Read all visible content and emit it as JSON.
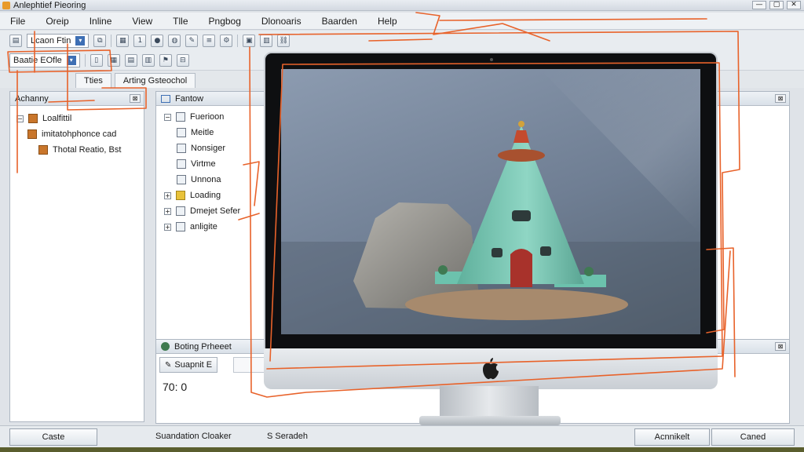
{
  "window": {
    "title": "Anlephtief Pieoring",
    "controls": [
      "—",
      "▢",
      "✕"
    ]
  },
  "menu": [
    "File",
    "Oreip",
    "Inline",
    "View",
    "Tlle",
    "Pngbog",
    "Dlonoaris",
    "Baarden",
    "Help"
  ],
  "toolbar1": {
    "combo_label": "Lcaon Ftin"
  },
  "toolbar2": {
    "combo_label": "Baatie EOfle"
  },
  "tabs": [
    "Tties",
    "Arting Gsteochol"
  ],
  "left_panel": {
    "title": "Achanny",
    "items": [
      "Loalfittil",
      "imitatohphonce cad",
      "Thotal Reatio, Bst"
    ]
  },
  "mid_panel": {
    "title": "Fantow",
    "items": [
      "Fuerioon",
      "Meitle",
      "Nonsiger",
      "Virtme",
      "Unnona",
      "Loading",
      "Dmejet Sefer",
      "anligite"
    ]
  },
  "bottom_panel": {
    "title": "Boting Prheeet",
    "button_label": "Suapnit E",
    "value": "70: 0"
  },
  "status": {
    "left_button": "Caste",
    "text1": "Suandation Cloaker",
    "text2": "S Seradeh",
    "right_button1": "Acnnikelt",
    "right_button2": "Caned"
  },
  "colors": {
    "accent": "#e8622a",
    "teal_house": "#7ec8b6",
    "screen_bg": "#6f7e93"
  }
}
